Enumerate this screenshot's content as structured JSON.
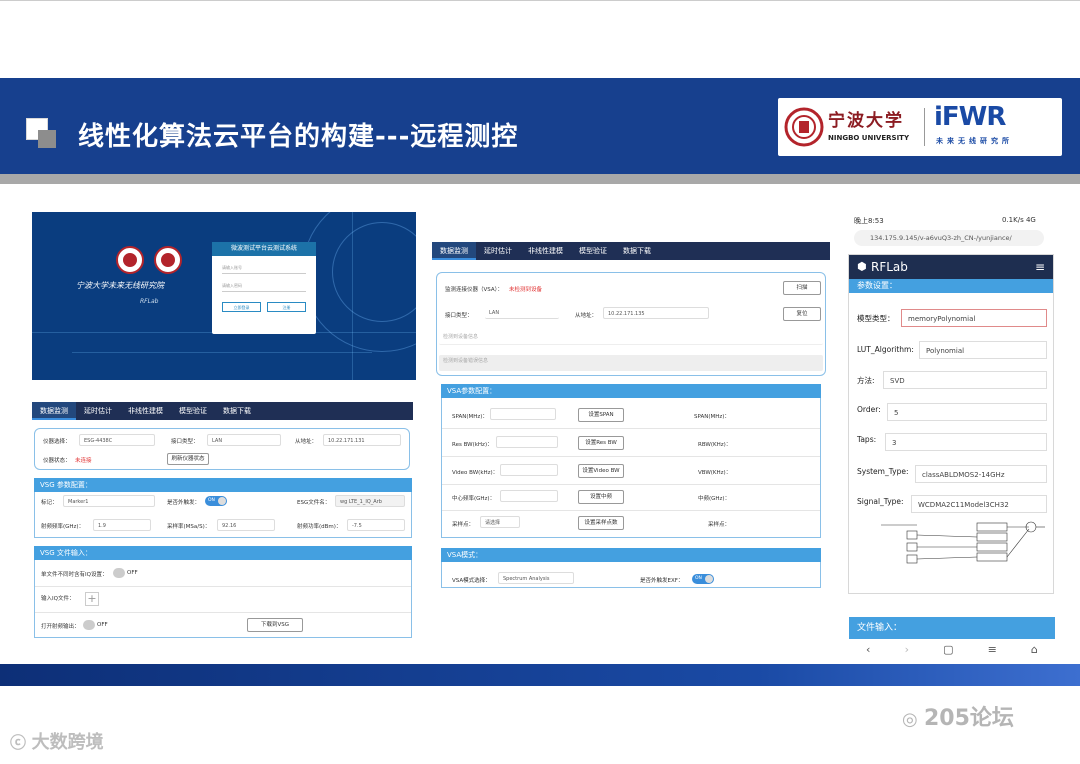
{
  "header": {
    "title": "线性化算法云平台的构建---远程测控",
    "university_cn": "宁波大学",
    "university_en": "NINGBO UNIVERSITY",
    "lab_logo": "iFWR",
    "lab_sub": "未来无线研究所",
    "colors": {
      "banner": "#17408e",
      "accent": "#44a0e0"
    }
  },
  "login_panel": {
    "system_title": "微波测试平台云测试系统",
    "institute": "宁波大学未来无线研究院",
    "brand": "RFLab",
    "user_placeholder": "请输入账号",
    "pass_placeholder": "请输入密码",
    "login_button": "立即登录",
    "register_button": "注册"
  },
  "vsg_panel": {
    "tabs": [
      "数据监测",
      "延时估计",
      "非线性建模",
      "模型验证",
      "数据下载"
    ],
    "instrument_label": "仪器选择：",
    "instrument_value": "ESG-4438C",
    "port_type_label": "接口类型：",
    "port_type_value": "LAN",
    "slave_label": "从地址：",
    "slave_value": "10.22.171.131",
    "status_label": "仪器状态：",
    "status_value": "未连接",
    "refresh_button": "刷新仪器状态",
    "vsg_config_title": "VSG 参数配置：",
    "marker_label": "标记：",
    "marker_value": "Marker1",
    "ext_trigger_label": "是否外触发：",
    "toggle_on": "ON",
    "esg_file_label": "ESG文件名：",
    "esg_file_value": "wg LTE_1_IQ_Arb",
    "center_freq_label": "射频频率(GHz)：",
    "center_freq_value": "1.9",
    "sample_rate_label": "采样率(MSa/S)：",
    "sample_rate_value": "92.16",
    "power_label": "射频功率(dBm)：",
    "power_value": "-7.5",
    "vsg_file_title": "VSG 文件输入：",
    "single_file_label": "单文件不同时含有IQ设置：",
    "toggle_off": "OFF",
    "iq_file_label": "输入IQ文件：",
    "rf_output_label": "打开射频输出：",
    "download_button": "下载到VSG"
  },
  "vsa_panel": {
    "tabs": [
      "数据监测",
      "延时估计",
      "非线性建模",
      "模型验证",
      "数据下载"
    ],
    "monitor_label": "监测连接仪器（VSA）：",
    "monitor_status": "未检测到设备",
    "scan_button": "扫描",
    "port_label": "接口类型：",
    "port_value": "LAN",
    "slave_label": "从地址：",
    "slave_value": "10.22.171.135",
    "reset_button": "复位",
    "info_line1": "检测到设备信息",
    "info_line2": "检测到设备错误信息",
    "config_title": "VSA参数配置：",
    "rows": [
      {
        "label": "SPAN(MHz)：",
        "button": "设置SPAN",
        "readout": "SPAN(MHz)："
      },
      {
        "label": "Res BW(kHz)：",
        "button": "设置Res BW",
        "readout": "RBW(KHz)："
      },
      {
        "label": "Video BW(kHz)：",
        "button": "设置Video BW",
        "readout": "VBW(KHz)："
      },
      {
        "label": "中心频率(GHz)：",
        "button": "设置中频",
        "readout": "中频(GHz)："
      },
      {
        "label": "采样点：",
        "button": "设置采样点数",
        "readout": "采样点：",
        "select": "请选择"
      }
    ],
    "mode_title": "VSA模式：",
    "mode_label": "VSA模式选择：",
    "mode_value": "Spectrum Analysis",
    "ext_trigger_label": "是否外触发EXF：",
    "toggle_on": "ON"
  },
  "phone": {
    "time": "晚上8:53",
    "net": "0.1K/s 4G",
    "url": "134.175.9.145/v-a6vuQ3-zh_CN-/yunjiance/",
    "app_title": "RFLab",
    "param_section": "参数设置：",
    "params": [
      {
        "label": "模型类型：",
        "value": "memoryPolynomial"
      },
      {
        "label": "LUT_Algorithm:",
        "value": "Polynomial"
      },
      {
        "label": "方法:",
        "value": "SVD"
      },
      {
        "label": "Order:",
        "value": "5"
      },
      {
        "label": "Taps:",
        "value": "3"
      },
      {
        "label": "System_Type:",
        "value": "classABLDMOS2-14GHz"
      },
      {
        "label": "Signal_Type:",
        "value": "WCDMA2C11Model3CH32"
      }
    ],
    "file_section": "文件输入："
  },
  "watermarks": {
    "left": "大数跨境",
    "right": "205论坛"
  }
}
